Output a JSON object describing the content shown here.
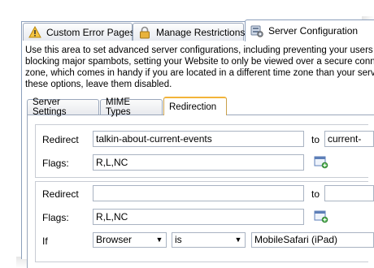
{
  "tabs": [
    {
      "label": "Custom Error Pages",
      "icon": "warning-icon"
    },
    {
      "label": "Manage Restrictions",
      "icon": "lock-icon"
    },
    {
      "label": "Server Configuration",
      "icon": "server-config-icon"
    }
  ],
  "description": [
    "Use this area to set advanced server configurations, including preventing your users",
    "blocking major spambots, setting your Website to only be viewed over a secure conn",
    "zone, which comes in handy if you are located in a different time zone than your serv",
    "these options, leave them disabled."
  ],
  "subtabs": [
    "Server Settings",
    "MIME Types",
    "Redirection"
  ],
  "redirects": [
    {
      "redirect_label": "Redirect",
      "from": "talkin-about-current-events",
      "to_label": "to",
      "to": "current-",
      "flags_label": "Flags:",
      "flags": "R,L,NC"
    },
    {
      "redirect_label": "Redirect",
      "from": "",
      "to_label": "to",
      "to": "",
      "flags_label": "Flags:",
      "flags": "R,L,NC",
      "if_label": "If",
      "condition_field": "Browser",
      "operator": "is",
      "value": "MobileSafari (iPad)"
    }
  ]
}
